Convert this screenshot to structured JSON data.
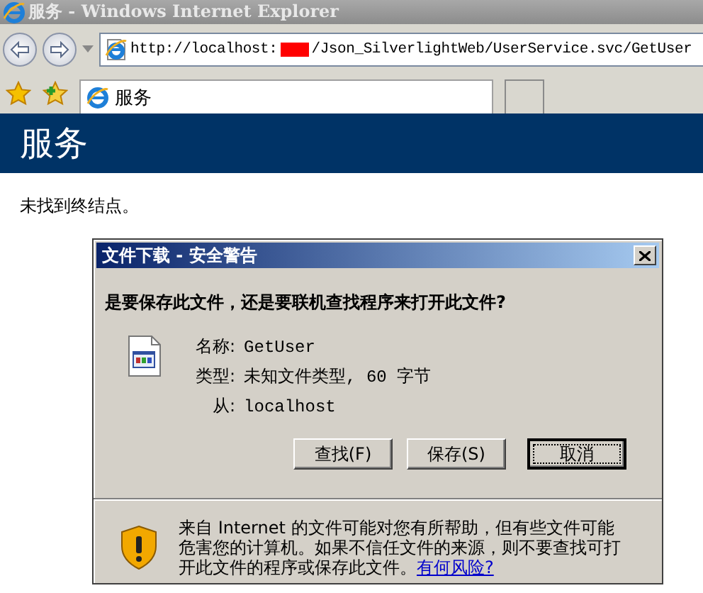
{
  "window": {
    "title": "服务 - Windows Internet Explorer"
  },
  "address_bar": {
    "url_start": "http://localhost:",
    "url_end": "/Json_SilverlightWeb/UserService.svc/GetUser"
  },
  "tabs": [
    {
      "label": "服务",
      "selected": true
    }
  ],
  "page": {
    "heading": "服务",
    "message": "未找到终结点。"
  },
  "dialog": {
    "title": "文件下载 - 安全警告",
    "question": "是要保存此文件，还是要联机查找程序来打开此文件?",
    "fields": [
      {
        "label": "名称:",
        "value": "GetUser"
      },
      {
        "label": "类型:",
        "value": "未知文件类型, 60 字节"
      },
      {
        "label": "从:",
        "value": "localhost"
      }
    ],
    "buttons": [
      {
        "label": "查找(F)",
        "default": false
      },
      {
        "label": "保存(S)",
        "default": false
      },
      {
        "label": "取消",
        "default": true
      }
    ],
    "warning": {
      "text": "来自 Internet 的文件可能对您有所帮助，但有些文件可能危害您的计算机。如果不信任文件的来源，则不要查找可打开此文件的程序或保存此文件。",
      "link": "有何风险?"
    }
  }
}
